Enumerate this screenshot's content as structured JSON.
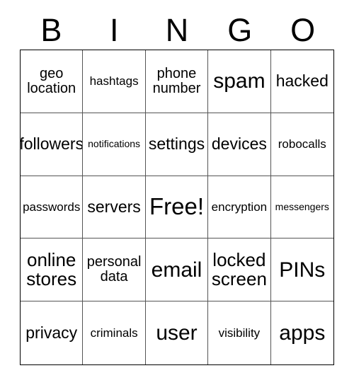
{
  "card": {
    "header_letters": [
      "B",
      "I",
      "N",
      "G",
      "O"
    ],
    "free_space_label": "Free!",
    "grid": {
      "columns": 5,
      "rows": 5,
      "cells": [
        {
          "text": "geo\nlocation",
          "size": "md"
        },
        {
          "text": "hashtags",
          "size": "sm"
        },
        {
          "text": "phone\nnumber",
          "size": "md"
        },
        {
          "text": "spam",
          "size": "xxl"
        },
        {
          "text": "hacked",
          "size": "lg"
        },
        {
          "text": "followers",
          "size": "lg"
        },
        {
          "text": "notifications",
          "size": "xs"
        },
        {
          "text": "settings",
          "size": "lg"
        },
        {
          "text": "devices",
          "size": "lg"
        },
        {
          "text": "robocalls",
          "size": "sm"
        },
        {
          "text": "passwords",
          "size": "sm"
        },
        {
          "text": "servers",
          "size": "lg"
        },
        {
          "text": "Free!",
          "size": "free"
        },
        {
          "text": "encryption",
          "size": "sm"
        },
        {
          "text": "messengers",
          "size": "xs"
        },
        {
          "text": "online\nstores",
          "size": "xl"
        },
        {
          "text": "personal\ndata",
          "size": "md"
        },
        {
          "text": "email",
          "size": "xxl"
        },
        {
          "text": "locked\nscreen",
          "size": "xl"
        },
        {
          "text": "PINs",
          "size": "xxl"
        },
        {
          "text": "privacy",
          "size": "lg"
        },
        {
          "text": "criminals",
          "size": "sm"
        },
        {
          "text": "user",
          "size": "xxl"
        },
        {
          "text": "visibility",
          "size": "sm"
        },
        {
          "text": "apps",
          "size": "xxl"
        }
      ]
    }
  },
  "colors": {
    "background": "#ffffff",
    "text": "#000000",
    "outer_border": "#000000",
    "inner_border": "#555555"
  }
}
